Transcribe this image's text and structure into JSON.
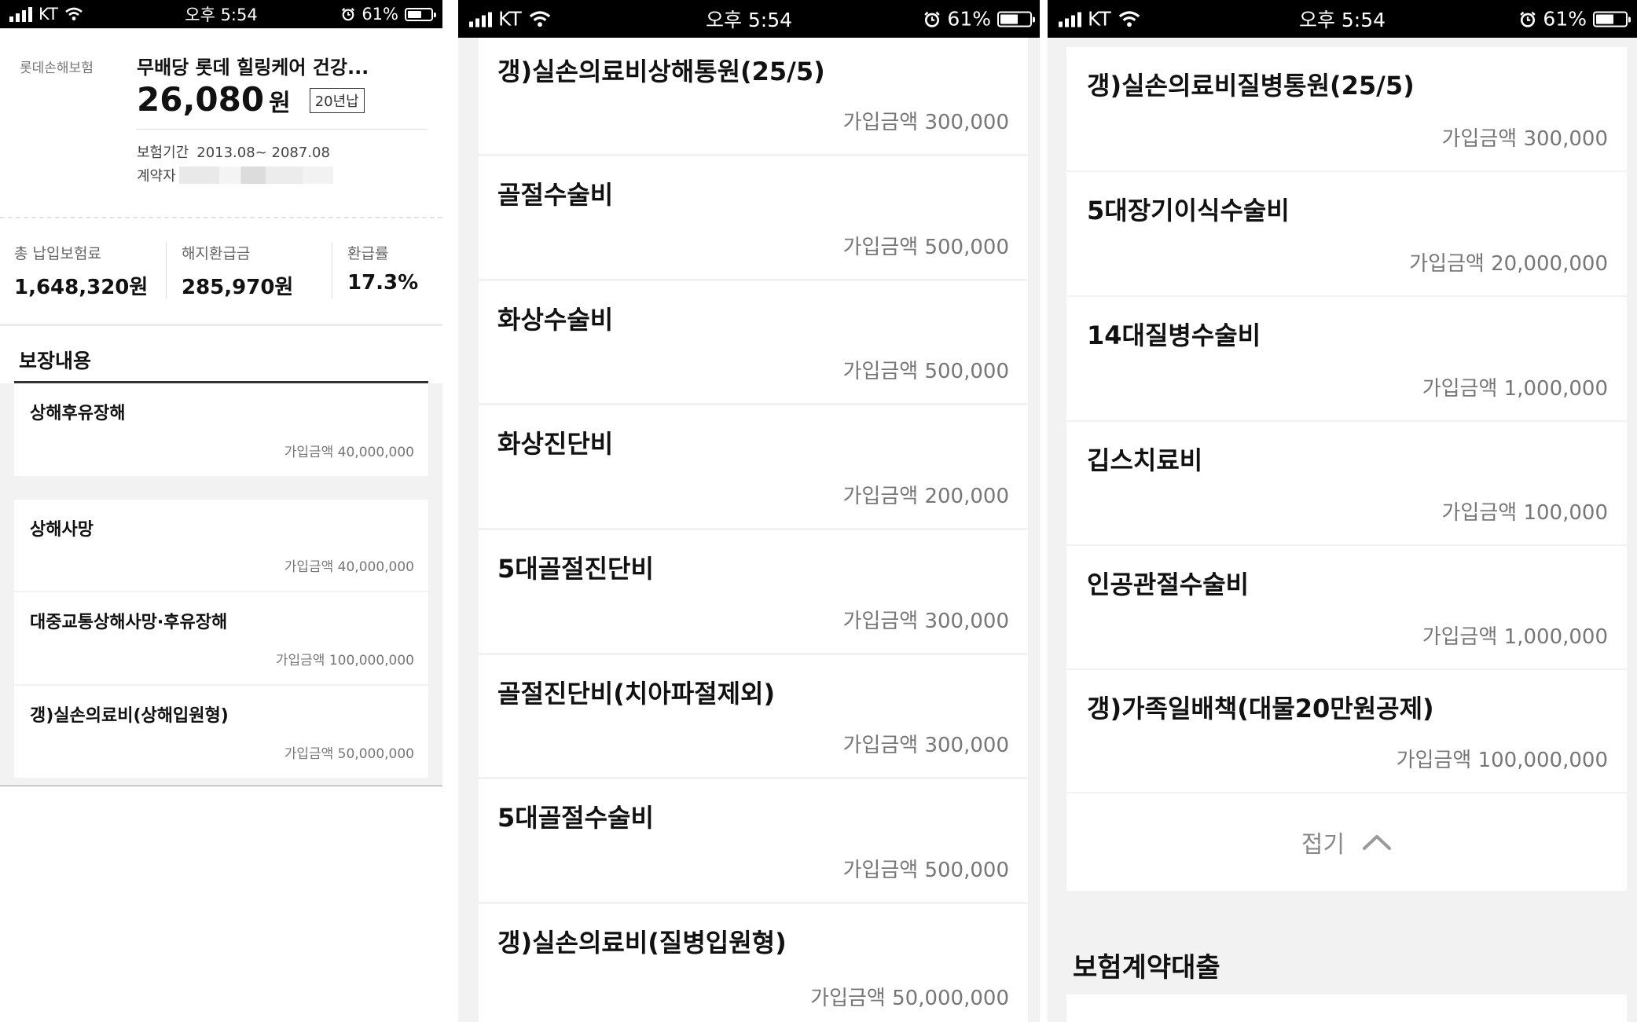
{
  "status": {
    "carrier": "KT",
    "time": "오후 5:54",
    "battery": "61%"
  },
  "policy": {
    "company": "롯데손해보험",
    "product_name": "무배당 롯데 힐링케어 건강...",
    "premium_amount": "26,080",
    "premium_unit": "원",
    "payment_term": "20년납",
    "period_label": "보험기간",
    "period_value": "2013.08~ 2087.08",
    "contractor_label": "계약자"
  },
  "summary": {
    "total_paid_label": "총 납입보험료",
    "total_paid_value": "1,648,320원",
    "surrender_label": "해지환급금",
    "surrender_value": "285,970원",
    "refund_rate_label": "환급률",
    "refund_rate_value": "17.3%"
  },
  "coverage": {
    "section_title": "보장내용",
    "amount_prefix": "가입금액",
    "panel1": [
      {
        "name": "상해후유장해",
        "amount": "40,000,000"
      },
      {
        "name": "상해사망",
        "amount": "40,000,000"
      },
      {
        "name": "대중교통상해사망·후유장해",
        "amount": "100,000,000"
      },
      {
        "name": "갱)실손의료비(상해입원형)",
        "amount": "50,000,000"
      }
    ],
    "panel2": [
      {
        "name": "갱)실손의료비상해통원(25/5)",
        "amount": "300,000"
      },
      {
        "name": "골절수술비",
        "amount": "500,000"
      },
      {
        "name": "화상수술비",
        "amount": "500,000"
      },
      {
        "name": "화상진단비",
        "amount": "200,000"
      },
      {
        "name": "5대골절진단비",
        "amount": "300,000"
      },
      {
        "name": "골절진단비(치아파절제외)",
        "amount": "300,000"
      },
      {
        "name": "5대골절수술비",
        "amount": "500,000"
      },
      {
        "name": "갱)실손의료비(질병입원형)",
        "amount": "50,000,000"
      }
    ],
    "panel3": [
      {
        "name": "갱)실손의료비질병통원(25/5)",
        "amount": "300,000"
      },
      {
        "name": "5대장기이식수술비",
        "amount": "20,000,000"
      },
      {
        "name": "14대질병수술비",
        "amount": "1,000,000"
      },
      {
        "name": "깁스치료비",
        "amount": "100,000"
      },
      {
        "name": "인공관절수술비",
        "amount": "1,000,000"
      },
      {
        "name": "갱)가족일배책(대물20만원공제)",
        "amount": "100,000,000"
      }
    ],
    "fold_label": "접기"
  },
  "loan": {
    "section_title": "보험계약대출"
  },
  "icons": {
    "signal": "signal-bars-icon",
    "wifi": "wifi-icon",
    "alarm": "alarm-icon",
    "battery": "battery-icon",
    "fold": "chevron-up-icon"
  },
  "battery_level": 0.61
}
